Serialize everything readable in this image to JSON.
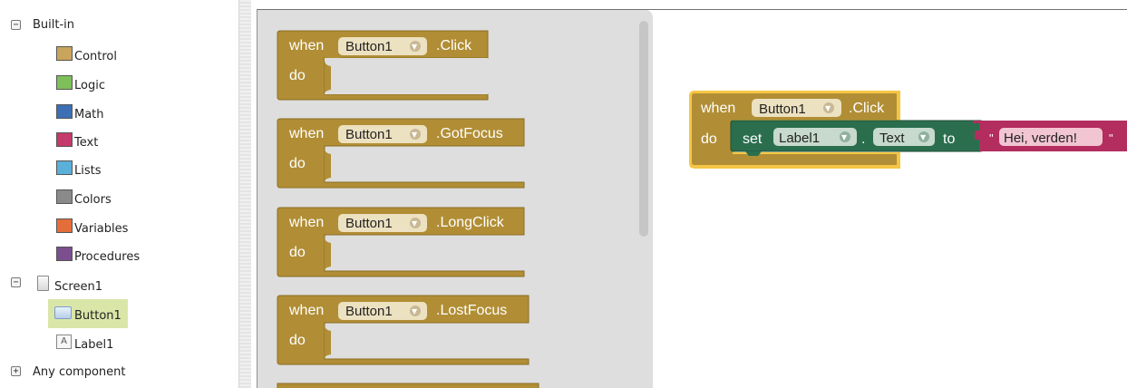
{
  "tree": {
    "builtin": {
      "toggle": "−",
      "label": "Built-in"
    },
    "categories": [
      {
        "label": "Control",
        "color": "#c9a45c"
      },
      {
        "label": "Logic",
        "color": "#7ebf5a"
      },
      {
        "label": "Math",
        "color": "#3d6fb4"
      },
      {
        "label": "Text",
        "color": "#c43a6a"
      },
      {
        "label": "Lists",
        "color": "#5bb0d9"
      },
      {
        "label": "Colors",
        "color": "#8a8a8a"
      },
      {
        "label": "Variables",
        "color": "#e36e3a"
      },
      {
        "label": "Procedures",
        "color": "#7b4e8d"
      }
    ],
    "screen": {
      "toggle": "−",
      "label": "Screen1"
    },
    "components": [
      {
        "label": "Button1",
        "selected": true
      },
      {
        "label": "Label1",
        "icon_text": "A"
      }
    ],
    "any": {
      "toggle": "+",
      "label": "Any component"
    }
  },
  "flyout": {
    "blocks": [
      {
        "when": "when",
        "component": "Button1",
        "event": ".Click",
        "do": "do"
      },
      {
        "when": "when",
        "component": "Button1",
        "event": ".GotFocus",
        "do": "do"
      },
      {
        "when": "when",
        "component": "Button1",
        "event": ".LongClick",
        "do": "do"
      },
      {
        "when": "when",
        "component": "Button1",
        "event": ".LostFocus",
        "do": "do"
      }
    ]
  },
  "workspace": {
    "event_block": {
      "when": "when",
      "component": "Button1",
      "event": ".Click",
      "do": "do"
    },
    "set_block": {
      "set": "set",
      "component": "Label1",
      "dot": ".",
      "property": "Text",
      "to": "to"
    },
    "text_block": {
      "open_quote": "\"",
      "value": "Hei, verden!",
      "close_quote": "\""
    }
  },
  "colors": {
    "event_fill": "#b18e35",
    "event_stroke": "#8a6c22",
    "field_bg": "#ece1c0",
    "selected_outline": "#f5c644",
    "setter_fill": "#2b6e4e",
    "text_fill": "#b32d5e"
  },
  "icons": {
    "dropdown": "triangle-down",
    "toggle_expand": "plus-box",
    "toggle_collapse": "minus-box"
  }
}
